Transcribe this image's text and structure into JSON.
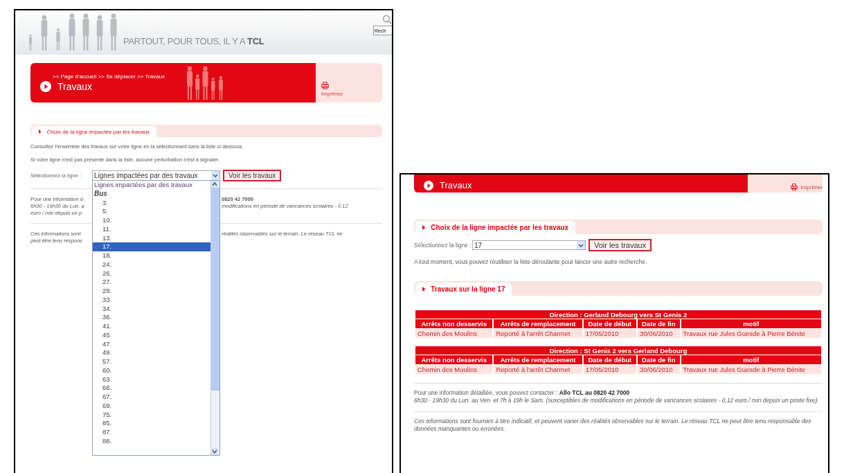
{
  "left": {
    "slogan": "PARTOUT, POUR TOUS, IL Y A **TCL**",
    "search_value": "Rech",
    "banner": {
      "breadcrumb": ">> Page d'accueil >> Se déplacer >> Travaux",
      "title": "Travaux",
      "print_label": "Imprimer"
    },
    "section_title": "Choix de la ligne impactée par les travaux",
    "paragraphs": [
      "Consultez l'ensemble des travaux sur votre ligne en la sélectionnant dans la liste ci-dessous.",
      "Si votre ligne n'est pas présente dans la liste, aucune perturbation n'est à signaler."
    ],
    "select": {
      "label": "Sélectionnez la ligne :",
      "value": "Lignes impactées par des travaux",
      "button": "Voir les travaux"
    },
    "dropdown": {
      "items": [
        {
          "kind": "option",
          "label": "Lignes impactées par des travaux",
          "selected": false
        },
        {
          "kind": "group",
          "label": "Bus"
        },
        {
          "kind": "option",
          "label": "3.",
          "selected": false
        },
        {
          "kind": "option",
          "label": "5.",
          "selected": false
        },
        {
          "kind": "option",
          "label": "10.",
          "selected": false
        },
        {
          "kind": "option",
          "label": "11.",
          "selected": false
        },
        {
          "kind": "option",
          "label": "13.",
          "selected": false
        },
        {
          "kind": "option",
          "label": "17.",
          "selected": true
        },
        {
          "kind": "option",
          "label": "18.",
          "selected": false
        },
        {
          "kind": "option",
          "label": "24.",
          "selected": false
        },
        {
          "kind": "option",
          "label": "26.",
          "selected": false
        },
        {
          "kind": "option",
          "label": "27.",
          "selected": false
        },
        {
          "kind": "option",
          "label": "29.",
          "selected": false
        },
        {
          "kind": "option",
          "label": "33.",
          "selected": false
        },
        {
          "kind": "option",
          "label": "34.",
          "selected": false
        },
        {
          "kind": "option",
          "label": "36.",
          "selected": false
        },
        {
          "kind": "option",
          "label": "41.",
          "selected": false
        },
        {
          "kind": "option",
          "label": "45.",
          "selected": false
        },
        {
          "kind": "option",
          "label": "47.",
          "selected": false
        },
        {
          "kind": "option",
          "label": "49.",
          "selected": false
        },
        {
          "kind": "option",
          "label": "57.",
          "selected": false
        },
        {
          "kind": "option",
          "label": "60.",
          "selected": false
        },
        {
          "kind": "option",
          "label": "63.",
          "selected": false
        },
        {
          "kind": "option",
          "label": "66.",
          "selected": false
        },
        {
          "kind": "option",
          "label": "67.",
          "selected": false
        },
        {
          "kind": "option",
          "label": "69.",
          "selected": false
        },
        {
          "kind": "option",
          "label": "75.",
          "selected": false
        },
        {
          "kind": "option",
          "label": "85.",
          "selected": false
        },
        {
          "kind": "option",
          "label": "87.",
          "selected": false
        },
        {
          "kind": "option",
          "label": "88.",
          "selected": false
        }
      ]
    },
    "info": [
      {
        "kind": "contact",
        "left": "Pour une information d",
        "right": "0820 42 7000"
      },
      {
        "kind": "hours",
        "left": "6h30 - 19h30 du Lun. a",
        "right": "modifications en période de vancances scolaires - 0,12"
      },
      {
        "kind": "hours",
        "left": "euro / min depuis un p"
      }
    ],
    "disclaimer": [
      {
        "left": "Ces informations sont",
        "right": "réalités observables sur le terrain. Le réseau TCL ne"
      },
      {
        "left": "peut être tenu respons"
      }
    ]
  },
  "right": {
    "banner": {
      "title": "Travaux",
      "print_label": "Imprimer"
    },
    "section_title": "Choix de la ligne impactée par les travaux",
    "select": {
      "label": "Sélectionnez la ligne :",
      "value": "17",
      "button": "Voir les travaux"
    },
    "hint": "A tout moment, vous pouvez réutiliser la liste déroulante pour lancer une autre recherche.",
    "results_title": "Travaux sur la ligne 17",
    "tables": [
      {
        "direction": "Direction : Gerland Debourg vers St Genis 2",
        "columns": [
          "Arrêts non desservis",
          "Arrêts de remplacement",
          "Date de début",
          "Date de fin",
          "motif"
        ],
        "rows": [
          [
            "Chemin des Moulins",
            "Reporté à l'arrêt Charmet",
            "17/05/2010",
            "30/06/2010",
            "Travaux rue Jules Guesde à Pierre Bénite"
          ]
        ]
      },
      {
        "direction": "Direction : St Genis 2 vers Gerland Debourg",
        "columns": [
          "Arrêts non desservis",
          "Arrêts de remplacement",
          "Date de début",
          "Date de fin",
          "motif"
        ],
        "rows": [
          [
            "Chemin des Moulins",
            "Reporté à l'arrêt Charmet",
            "17/05/2010",
            "30/06/2010",
            "Travaux rue Jules Guesde à Pierre Bénite"
          ]
        ]
      }
    ],
    "info": "Pour une information détaillée, vous pouvez contacter : **Allo TCL au 0820 42 7000**",
    "hours": "6h30 - 19h30 du Lun. au Ven. et 7h à 19h le Sam. (susceptibles de modifications en période de vancances scolaires - 0,12 euro / min depuis un poste fixe).",
    "disclaimer": "Ces informations sont fournies à titre indicatif, et peuvent varier des réalités observables sur le terrain. Le réseau TCL ne peut être tenu responsable des données manquantes ou erronées."
  }
}
